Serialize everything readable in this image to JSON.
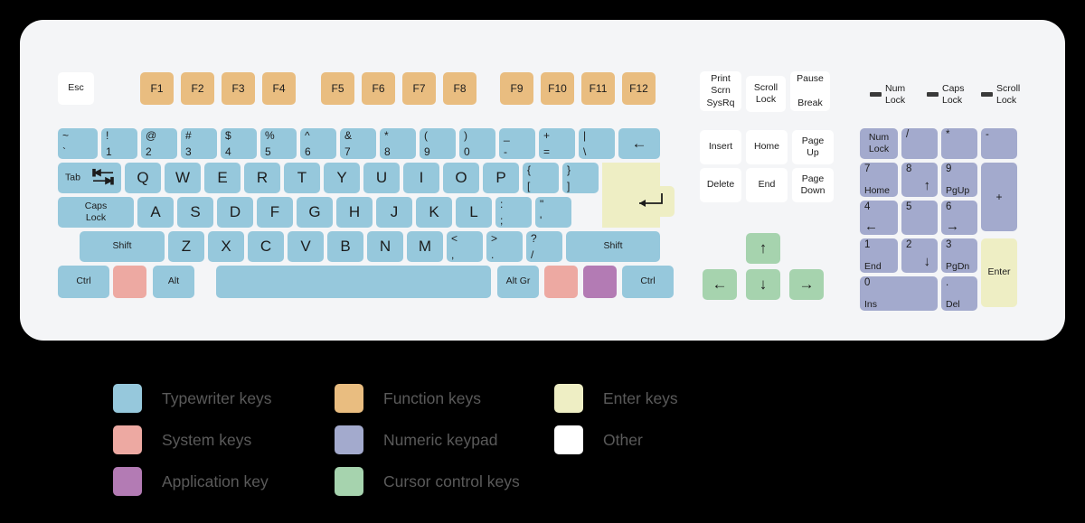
{
  "diagram": {
    "title": "Computer keyboard layout diagram",
    "panel_color": "#f4f5f7",
    "background_color": "#000000"
  },
  "colors": {
    "typewriter": "#96c8dc",
    "function": "#e9bd80",
    "system": "#eda9a2",
    "application": "#b37bb4",
    "enter": "#eeeec4",
    "numeric": "#a3aacd",
    "cursor": "#a6d3ae",
    "other": "#ffffff"
  },
  "escape": {
    "label": "Esc",
    "category": "other"
  },
  "function_keys": [
    {
      "label": "F1"
    },
    {
      "label": "F2"
    },
    {
      "label": "F3"
    },
    {
      "label": "F4"
    },
    {
      "label": "F5"
    },
    {
      "label": "F6"
    },
    {
      "label": "F7"
    },
    {
      "label": "F8"
    },
    {
      "label": "F9"
    },
    {
      "label": "F10"
    },
    {
      "label": "F11"
    },
    {
      "label": "F12"
    }
  ],
  "number_row": [
    {
      "upper": "~",
      "lower": "`"
    },
    {
      "upper": "!",
      "lower": "1"
    },
    {
      "upper": "@",
      "lower": "2"
    },
    {
      "upper": "#",
      "lower": "3"
    },
    {
      "upper": "$",
      "lower": "4"
    },
    {
      "upper": "%",
      "lower": "5"
    },
    {
      "upper": "^",
      "lower": "6"
    },
    {
      "upper": "&",
      "lower": "7"
    },
    {
      "upper": "*",
      "lower": "8"
    },
    {
      "upper": "(",
      "lower": "9"
    },
    {
      "upper": ")",
      "lower": "0"
    },
    {
      "upper": "_",
      "lower": "-"
    },
    {
      "upper": "+",
      "lower": "="
    },
    {
      "upper": "|",
      "lower": "\\"
    }
  ],
  "backspace": {
    "label": "←"
  },
  "tab": {
    "label": "Tab"
  },
  "qwerty_row": [
    {
      "label": "Q"
    },
    {
      "label": "W"
    },
    {
      "label": "E"
    },
    {
      "label": "R"
    },
    {
      "label": "T"
    },
    {
      "label": "Y"
    },
    {
      "label": "U"
    },
    {
      "label": "I"
    },
    {
      "label": "O"
    },
    {
      "label": "P"
    }
  ],
  "qwerty_row_extra": [
    {
      "upper": "{",
      "lower": "["
    },
    {
      "upper": "}",
      "lower": "]"
    }
  ],
  "caps_lock": {
    "label": "Caps\nLock"
  },
  "home_row": [
    {
      "label": "A"
    },
    {
      "label": "S"
    },
    {
      "label": "D"
    },
    {
      "label": "F"
    },
    {
      "label": "G"
    },
    {
      "label": "H"
    },
    {
      "label": "J"
    },
    {
      "label": "K"
    },
    {
      "label": "L"
    }
  ],
  "home_row_extra": [
    {
      "upper": ":",
      "lower": ";"
    },
    {
      "upper": "\"",
      "lower": "'"
    }
  ],
  "enter_key": {
    "label": "↵"
  },
  "shift_left": {
    "label": "Shift"
  },
  "bottom_letters": [
    {
      "label": "Z"
    },
    {
      "label": "X"
    },
    {
      "label": "C"
    },
    {
      "label": "V"
    },
    {
      "label": "B"
    },
    {
      "label": "N"
    },
    {
      "label": "M"
    }
  ],
  "bottom_letters_extra": [
    {
      "upper": "<",
      "lower": ","
    },
    {
      "upper": ">",
      "lower": "."
    },
    {
      "upper": "?",
      "lower": "/"
    }
  ],
  "shift_right": {
    "label": "Shift"
  },
  "modifier_row": {
    "ctrl_left": "Ctrl",
    "win_left": "",
    "alt_left": "Alt",
    "space": "",
    "alt_gr": "Alt Gr",
    "win_right": "",
    "menu": "",
    "ctrl_right": "Ctrl"
  },
  "system_cluster": [
    {
      "label": "Print\nScrn\nSysRq"
    },
    {
      "label": "Scroll\nLock"
    },
    {
      "label": "Pause\n\nBreak"
    }
  ],
  "nav_cluster": [
    {
      "label": "Insert"
    },
    {
      "label": "Home"
    },
    {
      "label": "Page\nUp"
    },
    {
      "label": "Delete"
    },
    {
      "label": "End"
    },
    {
      "label": "Page\nDown"
    }
  ],
  "arrow_keys": {
    "up": "↑",
    "left": "←",
    "down": "↓",
    "right": "→"
  },
  "leds": [
    {
      "label": "Num\nLock"
    },
    {
      "label": "Caps\nLock"
    },
    {
      "label": "Scroll\nLock"
    }
  ],
  "numpad": {
    "num_lock": "Num\nLock",
    "divide": "/",
    "multiply": "*",
    "minus": "-",
    "k7": {
      "top": "7",
      "bottom": "Home"
    },
    "k8": {
      "top": "8",
      "bottom": "↑"
    },
    "k9": {
      "top": "9",
      "bottom": "PgUp"
    },
    "plus": "+",
    "k4": {
      "top": "4",
      "bottom": "←"
    },
    "k5": {
      "top": "5",
      "bottom": ""
    },
    "k6": {
      "top": "6",
      "bottom": "→"
    },
    "k1": {
      "top": "1",
      "bottom": "End"
    },
    "k2": {
      "top": "2",
      "bottom": "↓"
    },
    "k3": {
      "top": "3",
      "bottom": "PgDn"
    },
    "enter": "Enter",
    "k0": {
      "top": "0",
      "bottom": "Ins"
    },
    "kdot": {
      "top": ".",
      "bottom": "Del"
    }
  },
  "legend": [
    {
      "label": "Typewriter keys",
      "color": "#96c8dc"
    },
    {
      "label": "Function keys",
      "color": "#e9bd80"
    },
    {
      "label": "Enter keys",
      "color": "#eeeec4"
    },
    {
      "label": "System keys",
      "color": "#eda9a2"
    },
    {
      "label": "Numeric keypad",
      "color": "#a3aacd"
    },
    {
      "label": "Other",
      "color": "#ffffff"
    },
    {
      "label": "Application key",
      "color": "#b37bb4"
    },
    {
      "label": "Cursor control keys",
      "color": "#a6d3ae"
    }
  ]
}
